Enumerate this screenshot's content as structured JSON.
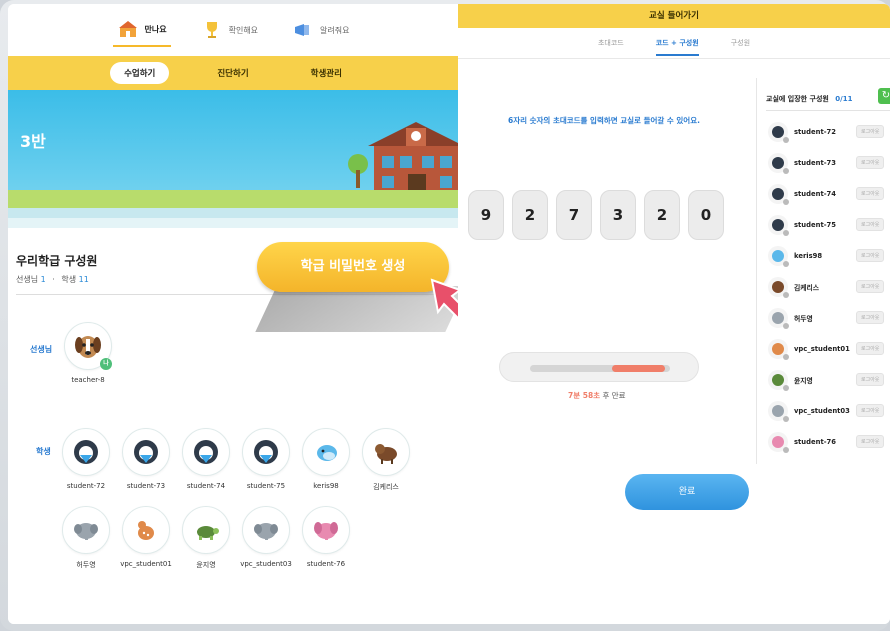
{
  "nav": {
    "tabs": [
      {
        "label": "만나요",
        "icon": "school-icon"
      },
      {
        "label": "확인해요",
        "icon": "trophy-icon"
      },
      {
        "label": "알려줘요",
        "icon": "megaphone-icon"
      }
    ]
  },
  "subnav": {
    "tabs": [
      "수업하기",
      "진단하기",
      "학생관리"
    ]
  },
  "banner": {
    "title": "3반"
  },
  "members": {
    "title": "우리학급 구성원",
    "teacher_label": "선생님",
    "teacher_count": "1",
    "sep": "·",
    "student_label": "학생",
    "student_count": "11",
    "teacher_role": "선생님",
    "student_role": "학생",
    "teacher": {
      "name": "teacher-8",
      "badge": "나"
    },
    "students": [
      "student-72",
      "student-73",
      "student-74",
      "student-75",
      "keris98",
      "김케리스",
      "허두영",
      "vpc_student01",
      "윤지영",
      "vpc_student03",
      "student-76"
    ]
  },
  "generate_button": {
    "label": "학급 비밀번호 생성"
  },
  "dialog": {
    "title": "교실 들어가기",
    "tabs": [
      "초대코드",
      "코드 + 구성원",
      "구성원"
    ],
    "instruction": "6자리 숫자의 초대코드를 입력하면 교실로 들어갈 수 있어요.",
    "code": [
      "9",
      "2",
      "7",
      "3",
      "2",
      "0"
    ],
    "progress_fraction": 0.38,
    "timer_value": "7분 58초",
    "timer_suffix": " 후 만료",
    "done_label": "완료",
    "roster_title": "교실에 입장한 구성원",
    "roster_count": "0/11",
    "roster": [
      {
        "name": "student-72",
        "status": "로그아웃"
      },
      {
        "name": "student-73",
        "status": "로그아웃"
      },
      {
        "name": "student-74",
        "status": "로그아웃"
      },
      {
        "name": "student-75",
        "status": "로그아웃"
      },
      {
        "name": "keris98",
        "status": "로그아웃"
      },
      {
        "name": "김케리스",
        "status": "로그아웃"
      },
      {
        "name": "허두영",
        "status": "로그아웃"
      },
      {
        "name": "vpc_student01",
        "status": "로그아웃"
      },
      {
        "name": "윤지영",
        "status": "로그아웃"
      },
      {
        "name": "vpc_student03",
        "status": "로그아웃"
      },
      {
        "name": "student-76",
        "status": "로그아웃"
      }
    ]
  },
  "colors": {
    "accent": "#f7d04a",
    "blue": "#2a7bd0",
    "progress": "#f07e69",
    "banner": "#3bbde8"
  }
}
